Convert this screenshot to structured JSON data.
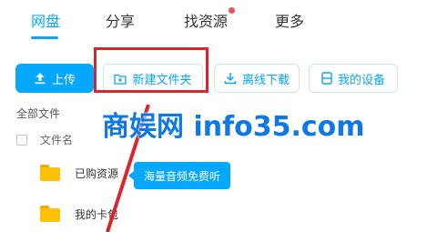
{
  "tabs": [
    {
      "label": "网盘",
      "active": true
    },
    {
      "label": "分享",
      "active": false
    },
    {
      "label": "找资源",
      "active": false,
      "has_notification_dot": true
    },
    {
      "label": "更多",
      "active": false
    }
  ],
  "toolbar": {
    "upload_label": "上传",
    "new_folder_label": "新建文件夹",
    "offline_download_label": "离线下载",
    "my_devices_label": "我的设备"
  },
  "breadcrumb": "全部文件",
  "list": {
    "column_filename": "文件名",
    "rows": [
      {
        "name": "已购资源"
      },
      {
        "name": "我的卡包"
      }
    ]
  },
  "tooltip": "海量音频免费听",
  "watermark": "商娱网 info35.com",
  "colors": {
    "accent": "#06a7ff",
    "highlight": "#d9262c",
    "folder": "#ffc107",
    "watermark": "#0e78e6"
  }
}
